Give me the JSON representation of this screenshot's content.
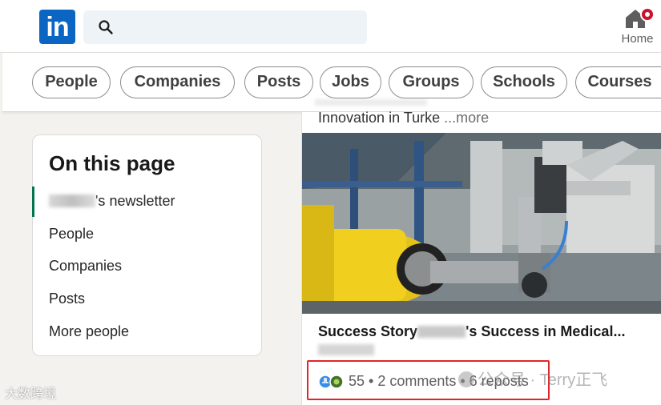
{
  "header": {
    "logo_text": "in",
    "search": {
      "value": "",
      "placeholder": ""
    },
    "home_label": "Home"
  },
  "filters": [
    "People",
    "Companies",
    "Posts",
    "Jobs",
    "Groups",
    "Schools",
    "Courses"
  ],
  "sidebar": {
    "title": "On this page",
    "items": [
      {
        "label": "'s newsletter",
        "active": true
      },
      {
        "label": "People"
      },
      {
        "label": "Companies"
      },
      {
        "label": "Posts"
      },
      {
        "label": "More people"
      }
    ]
  },
  "feed": {
    "prev_text": "Innovation in Turke",
    "more_label": "...more",
    "post_title_start": "Success Story",
    "post_title_end": "'s Success in Medical...",
    "social": "55 • 2 comments • 6 reposts"
  },
  "watermarks": {
    "right": "公众号 · Terry正飞",
    "left": "大数跨境"
  },
  "colors": {
    "brand": "#0a66c2",
    "highlight": "#e3252a",
    "notification": "#cb112d"
  }
}
